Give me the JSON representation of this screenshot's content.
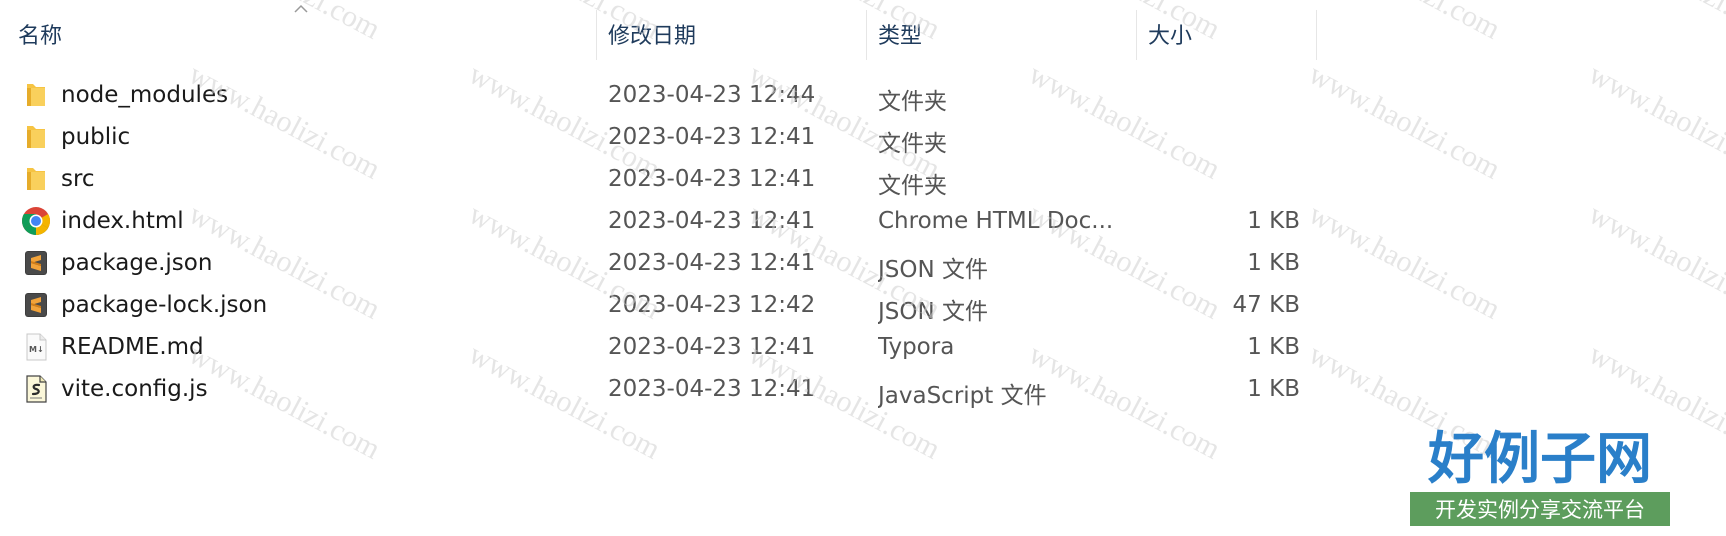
{
  "columns": {
    "name": "名称",
    "date_modified": "修改日期",
    "type": "类型",
    "size": "大小"
  },
  "sort": {
    "column": "name",
    "direction": "ascending"
  },
  "files": [
    {
      "name": "node_modules",
      "date": "2023-04-23 12:44",
      "type": "文件夹",
      "size": "",
      "icon": "folder-icon"
    },
    {
      "name": "public",
      "date": "2023-04-23 12:41",
      "type": "文件夹",
      "size": "",
      "icon": "folder-icon"
    },
    {
      "name": "src",
      "date": "2023-04-23 12:41",
      "type": "文件夹",
      "size": "",
      "icon": "folder-icon"
    },
    {
      "name": "index.html",
      "date": "2023-04-23 12:41",
      "type": "Chrome HTML Doc...",
      "size": "1 KB",
      "icon": "chrome-icon"
    },
    {
      "name": "package.json",
      "date": "2023-04-23 12:41",
      "type": "JSON 文件",
      "size": "1 KB",
      "icon": "sublime-text-icon"
    },
    {
      "name": "package-lock.json",
      "date": "2023-04-23 12:42",
      "type": "JSON 文件",
      "size": "47 KB",
      "icon": "sublime-text-icon"
    },
    {
      "name": "README.md",
      "date": "2023-04-23 12:41",
      "type": "Typora",
      "size": "1 KB",
      "icon": "markdown-file-icon"
    },
    {
      "name": "vite.config.js",
      "date": "2023-04-23 12:41",
      "type": "JavaScript 文件",
      "size": "1 KB",
      "icon": "script-file-icon"
    }
  ],
  "watermark": {
    "text": "www.haolizi.com"
  },
  "logo": {
    "title": "好例子网",
    "subtitle": "开发实例分享交流平台"
  },
  "colors": {
    "header_text": "#1f3b5c",
    "folder": "#f6c443",
    "logo_blue": "#2a7fc9",
    "logo_green": "#5d9d5d"
  }
}
